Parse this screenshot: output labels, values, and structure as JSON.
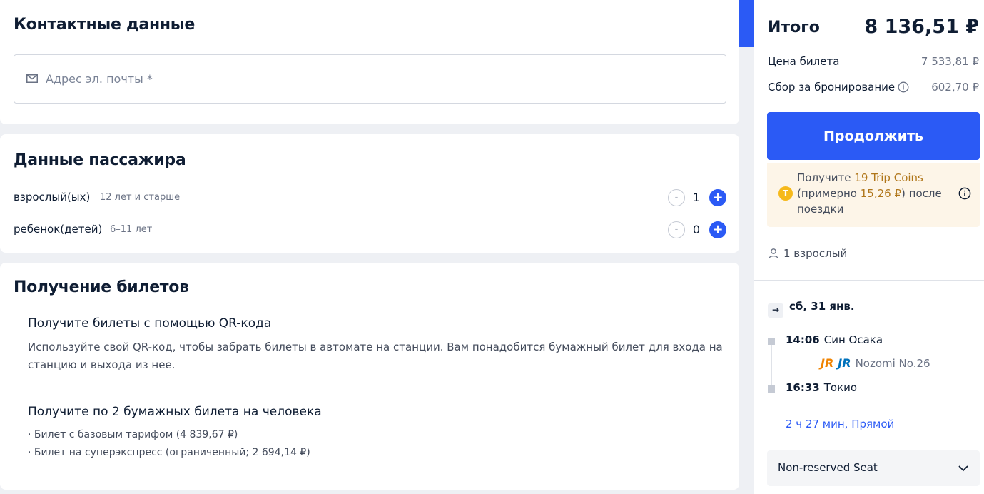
{
  "contact": {
    "title": "Контактные данные",
    "email_placeholder": "Адрес эл. почты *",
    "email_value": ""
  },
  "passengers": {
    "title": "Данные пассажира",
    "rows": [
      {
        "label": "взрослый(ых)",
        "sub": "12 лет и старше",
        "count": "1",
        "minus": "-",
        "plus": "+"
      },
      {
        "label": "ребенок(детей)",
        "sub": "6–11 лет",
        "count": "0",
        "minus": "-",
        "plus": "+"
      }
    ]
  },
  "tickets": {
    "title": "Получение билетов",
    "options": [
      {
        "title": "Получите билеты с помощью QR-кода",
        "desc_lines": [
          "Используйте свой QR-код, чтобы забрать билеты в автомате на станции. Вам понадобится бумажный билет для входа на",
          "станцию и выхода из нее."
        ]
      },
      {
        "title": "Получите по 2 бумажных билета на человека",
        "desc_lines": [
          "· Билет с базовым тарифом (4 839,67 ₽)",
          "· Билет на суперэкспресс (ограниченный; 2 694,14 ₽)"
        ]
      }
    ]
  },
  "summary": {
    "total_label": "Итого",
    "total_value": "8 136,51 ₽",
    "ticket_price_label": "Цена билета",
    "ticket_price_value": "7 533,81 ₽",
    "booking_fee_label": "Сбор за бронирование",
    "booking_fee_value": "602,70 ₽",
    "continue_label": "Продолжить",
    "coins": {
      "prefix": "Получите ",
      "coins_amount": "19 Trip Coins",
      "middle": "(примерно ",
      "money_amount": "15,26 ₽",
      "suffix": ") после поездки",
      "coin_glyph": "T"
    },
    "travellers": "1 взрослый",
    "trip": {
      "date": "сб, 31 янв.",
      "date_glyph": "→",
      "departure_time": "14:06",
      "departure_station": "Син Осака",
      "train_name": "Nozomi No.26",
      "logo_text": "JR",
      "arrival_time": "16:33",
      "arrival_station": "Токио",
      "duration": "2 ч 27 мин, Прямой"
    },
    "seat_type": "Non-reserved Seat"
  },
  "colors": {
    "accent": "#2b5af5",
    "coins_bg": "#fdf5e8",
    "coins_highlight": "#b0761a",
    "jr_orange": "#f08300",
    "jr_blue": "#0072bc"
  }
}
